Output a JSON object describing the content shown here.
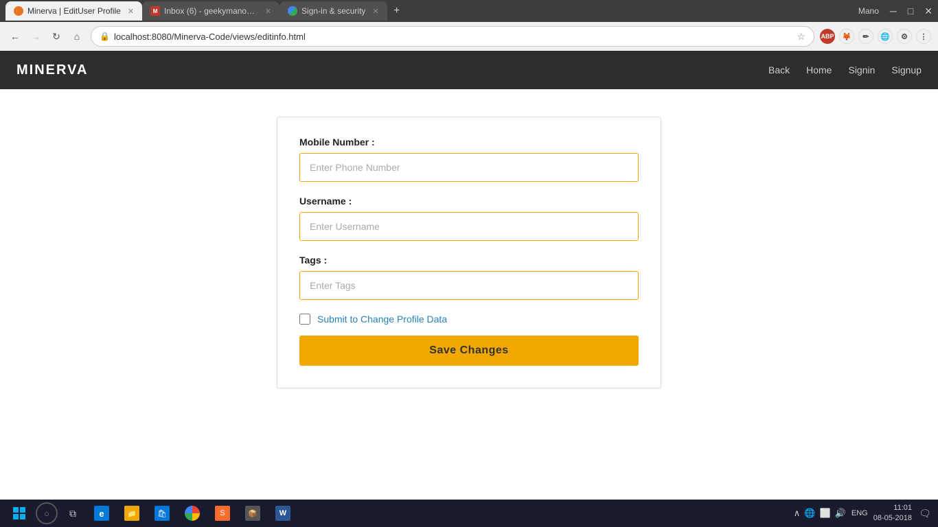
{
  "browser": {
    "tabs": [
      {
        "id": "tab1",
        "label": "Minerva | EditUser Profile",
        "active": true,
        "favicon_type": "orange"
      },
      {
        "id": "tab2",
        "label": "Inbox (6) - geekymano@...",
        "active": false,
        "favicon_type": "gmail"
      },
      {
        "id": "tab3",
        "label": "Sign-in & security",
        "active": false,
        "favicon_type": "google"
      }
    ],
    "user": "Mano",
    "address": "localhost:8080/Minerva-Code/views/editinfo.html"
  },
  "navbar": {
    "brand": "MINERVA",
    "links": [
      "Back",
      "Home",
      "Signin",
      "Signup"
    ]
  },
  "form": {
    "mobile_label": "Mobile Number :",
    "mobile_placeholder": "Enter Phone Number",
    "username_label": "Username :",
    "username_placeholder": "Enter Username",
    "tags_label": "Tags :",
    "tags_placeholder": "Enter Tags",
    "checkbox_label": "Submit to Change Profile Data",
    "save_button": "Save Changes"
  },
  "taskbar": {
    "time": "11:01",
    "date": "08-05-2018",
    "lang": "ENG"
  }
}
